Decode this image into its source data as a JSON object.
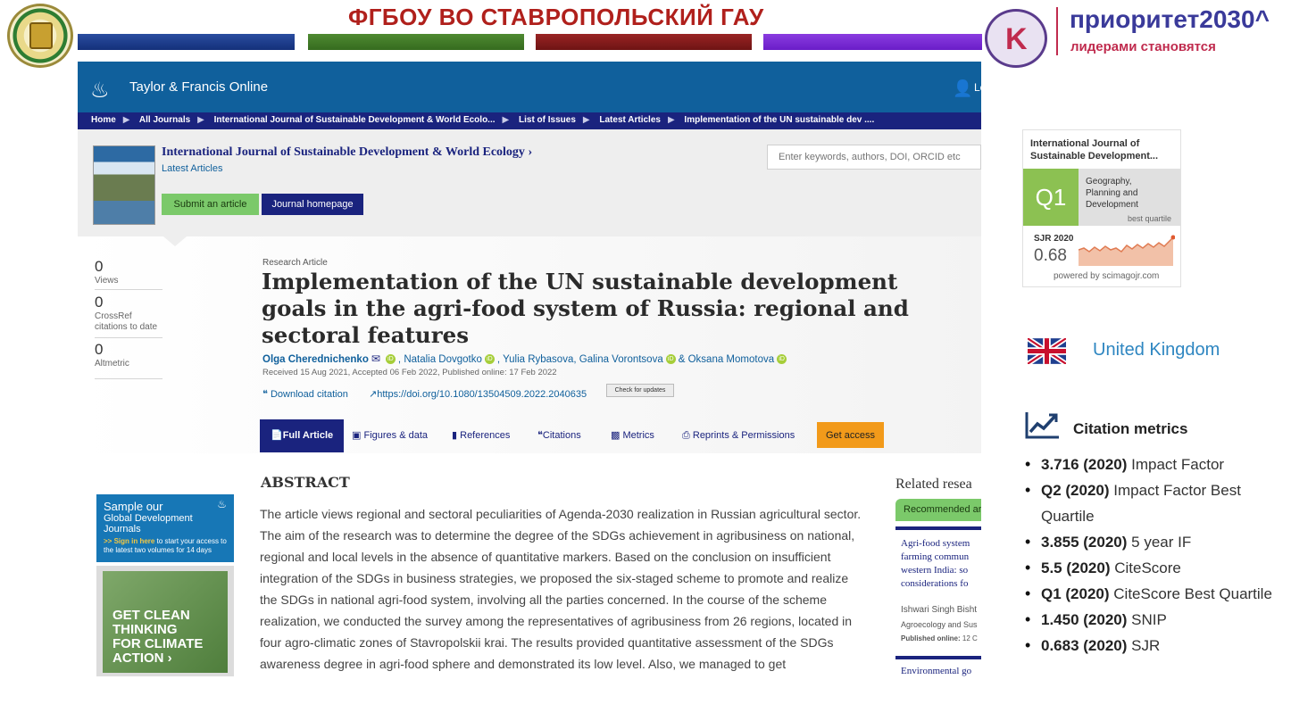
{
  "slide": {
    "title": "ФГБОУ ВО СТАВРОПОЛЬСКИЙ ГАУ",
    "priority_title": "приоритет2030^",
    "priority_subtitle": "лидерами становятся",
    "priority_seal_letter": "K"
  },
  "tf": {
    "logo_text": "Taylor & Francis Online",
    "login_text": "Lo",
    "breadcrumb": [
      "Home",
      "All Journals",
      "International Journal of Sustainable Development & World Ecolo...",
      "List of Issues",
      "Latest Articles",
      "Implementation of the UN sustainable dev ...."
    ],
    "journal": {
      "name": "International Journal of Sustainable Development & World Ecology",
      "latest": "Latest Articles",
      "submit_label": "Submit an article",
      "homepage_label": "Journal homepage"
    },
    "search": {
      "placeholder": "Enter keywords, authors, DOI, ORCID etc"
    },
    "metrics": [
      {
        "value": "0",
        "label": "Views"
      },
      {
        "value": "0",
        "label": "CrossRef citations to date"
      },
      {
        "value": "0",
        "label": "Altmetric"
      }
    ],
    "article": {
      "type": "Research Article",
      "title": "Implementation of the UN sustainable development goals in the agri-food system of Russia: regional and sectoral features",
      "authors": [
        "Olga Cherednichenko",
        "Natalia Dovgotko",
        "Yulia Rybasova",
        "Galina Vorontsova",
        "Oksana Momotova"
      ],
      "dates": "Received 15 Aug 2021, Accepted 06 Feb 2022, Published online: 17 Feb 2022",
      "download_citation": "Download citation",
      "doi": "https://doi.org/10.1080/13504509.2022.2040635",
      "check_updates": "Check for updates"
    },
    "tabs": {
      "full_article": "Full Article",
      "figures": "Figures & data",
      "references": "References",
      "citations": "Citations",
      "metrics": "Metrics",
      "reprints": "Reprints & Permissions",
      "get_access": "Get access"
    },
    "ads": {
      "sample_line1": "Sample our",
      "sample_line2": "Global Development Journals",
      "sample_signin": ">> Sign in here",
      "sample_rest": "to start your access to the latest two volumes for 14 days",
      "climate": "GET CLEAN\nTHINKING\nFOR CLIMATE\nACTION ›"
    },
    "abstract": {
      "heading": "ABSTRACT",
      "text": "The article views regional and sectoral peculiarities of Agenda-2030 realization in Russian agricultural sector. The aim of the research was to determine the degree of the SDGs achievement in agribusiness on national, regional and local levels in the absence of quantitative markers. Based on the conclusion on insufficient integration of the SDGs in business strategies, we proposed the six-staged scheme to promote and realize the SDGs in national agri-food system, involving all the parties concerned. In the course of the scheme realization, we conducted the survey among the representatives of agribusiness from 26 regions, located in four agro-climatic zones of Stavropolskii krai. The results provided quantitative assessment of the SDGs awareness degree in agri-food sphere and demonstrated its low level. Also, we managed to get"
    },
    "related": {
      "title": "Related resea",
      "tab": "Recommended ar",
      "item1_lines": [
        "Agri-food system",
        "farming commun",
        "western India: so",
        "considerations fo"
      ],
      "item1_author": "Ishwari Singh Bisht",
      "item1_journal": "Agroecology and Sus",
      "item1_published_label": "Published online:",
      "item1_published_value": "12 C",
      "item2_line": "Environmental go"
    }
  },
  "sjr": {
    "journal": "International Journal of\nSustainable Development...",
    "quartile": "Q1",
    "category": "Geography,\nPlanning and\nDevelopment",
    "best_quartile": "best quartile",
    "year_label": "SJR 2020",
    "value": "0.68",
    "powered": "powered by scimagojr.com"
  },
  "country": "United Kingdom",
  "citation_metrics": {
    "title": "Citation metrics",
    "items": [
      {
        "value": "3.716 (2020)",
        "label": "Impact Factor"
      },
      {
        "value": "Q2 (2020)",
        "label": "Impact Factor Best Quartile"
      },
      {
        "value": "3.855 (2020)",
        "label": "5 year IF"
      },
      {
        "value": "5.5 (2020)",
        "label": "CiteScore"
      },
      {
        "value": "Q1 (2020)",
        "label": "CiteScore Best Quartile"
      },
      {
        "value": "1.450 (2020)",
        "label": "SNIP"
      },
      {
        "value": "0.683 (2020)",
        "label": "SJR"
      }
    ]
  },
  "colors": {
    "tf_blue": "#10609c",
    "tf_navy": "#1a237e",
    "accent_green": "#7bc96a",
    "access_orange": "#f29a1a",
    "slide_red": "#b0201c"
  }
}
